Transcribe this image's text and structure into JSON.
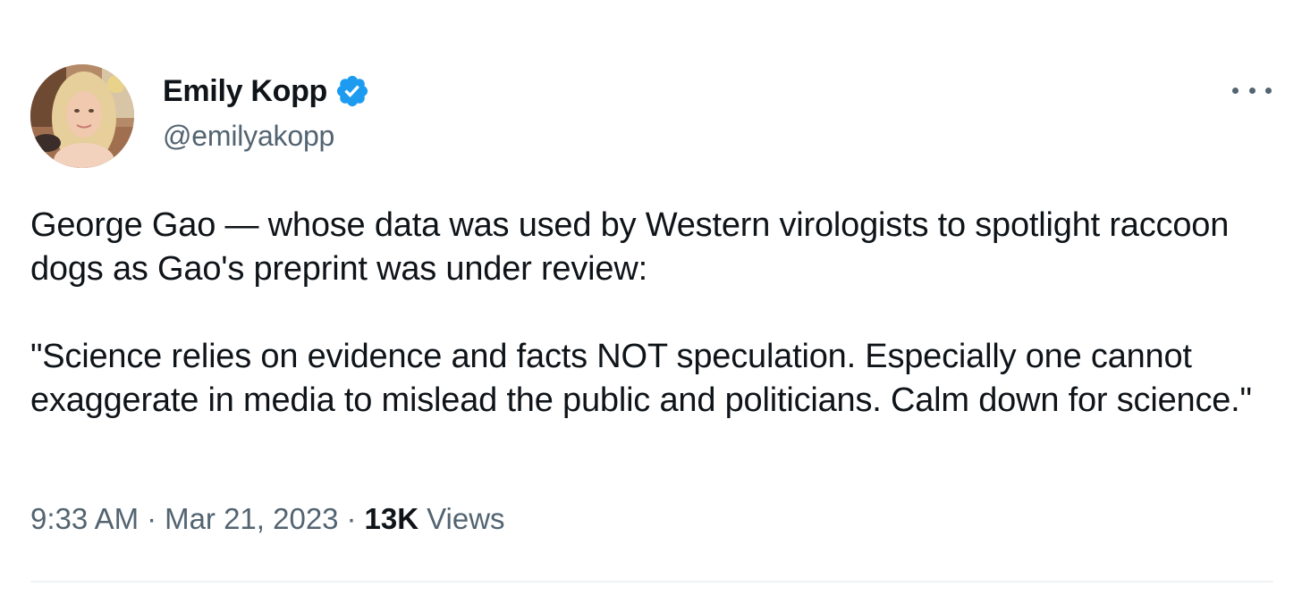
{
  "author": {
    "display_name": "Emily Kopp",
    "handle": "@emilyakopp",
    "verified": true,
    "avatar_icon": "profile-photo"
  },
  "tweet": {
    "paragraphs": [
      "George Gao — whose data was used by Western virologists to spotlight raccoon dogs as Gao's preprint was under review:",
      "\"Science relies on evidence and facts NOT speculation. Especially one cannot exaggerate in media to mislead the public and politicians. Calm down for science.\""
    ],
    "time": "9:33 AM",
    "date": "Mar 21, 2023",
    "views_count": "13K",
    "views_label": "Views",
    "separator": "·"
  },
  "icons": {
    "verified": "verified-badge-icon",
    "more": "more-options-icon"
  },
  "colors": {
    "text_primary": "#0f1419",
    "text_secondary": "#536471",
    "verified_blue": "#1d9bf0",
    "divider": "#eff3f4"
  }
}
